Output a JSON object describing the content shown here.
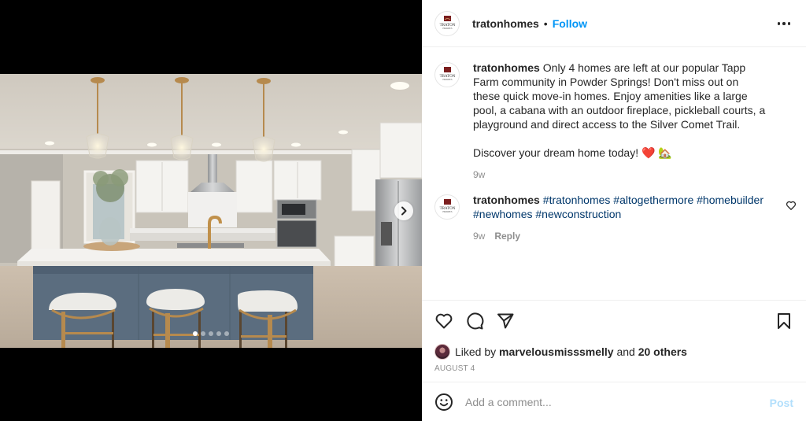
{
  "post": {
    "username": "tratonhomes",
    "header_separator": "•",
    "follow_label": "Follow",
    "more_options_icon": "more-horizontal-icon",
    "avatar_brand_line1": "TRATON",
    "avatar_brand_line2": "HOMES",
    "media": {
      "description": "Kitchen with three brass pendant lights, white cabinets, blue-gray island with white countertop and three stools",
      "carousel_total": 5,
      "carousel_active_index": 0,
      "next_icon": "chevron-right-icon"
    },
    "caption": {
      "username": "tratonhomes",
      "text": "Only 4 homes are left at our popular Tapp Farm community in Powder Springs! Don't miss out on these quick move-in homes. Enjoy amenities like a large pool, a cabana with an outdoor fireplace, pickleball courts, a playground and direct access to the Silver Comet Trail.\n\nDiscover your dream home today! ❤️ 🏡",
      "time": "9w"
    },
    "comments": [
      {
        "username": "tratonhomes",
        "hashtags": [
          "#tratonhomes",
          "#altogethermore",
          "#homebuilder",
          "#newhomes",
          "#newconstruction"
        ],
        "time": "9w",
        "reply_label": "Reply",
        "like_icon": "heart-outline-icon"
      }
    ],
    "actions": {
      "like_icon": "heart-icon",
      "comment_icon": "comment-icon",
      "share_icon": "paper-plane-icon",
      "save_icon": "bookmark-icon"
    },
    "likes": {
      "prefix": "Liked by",
      "liker": "marvelousmisssmelly",
      "connector": "and",
      "others": "20 others"
    },
    "date": "AUGUST 4",
    "add_comment": {
      "emoji_icon": "smiley-icon",
      "placeholder": "Add a comment...",
      "value": "",
      "post_label": "Post"
    }
  },
  "colors": {
    "accent": "#0095f6",
    "hashtag": "#00376b",
    "text": "#262626",
    "muted": "#8e8e8e",
    "post_disabled": "#b2dffc",
    "divider": "#efefef"
  }
}
